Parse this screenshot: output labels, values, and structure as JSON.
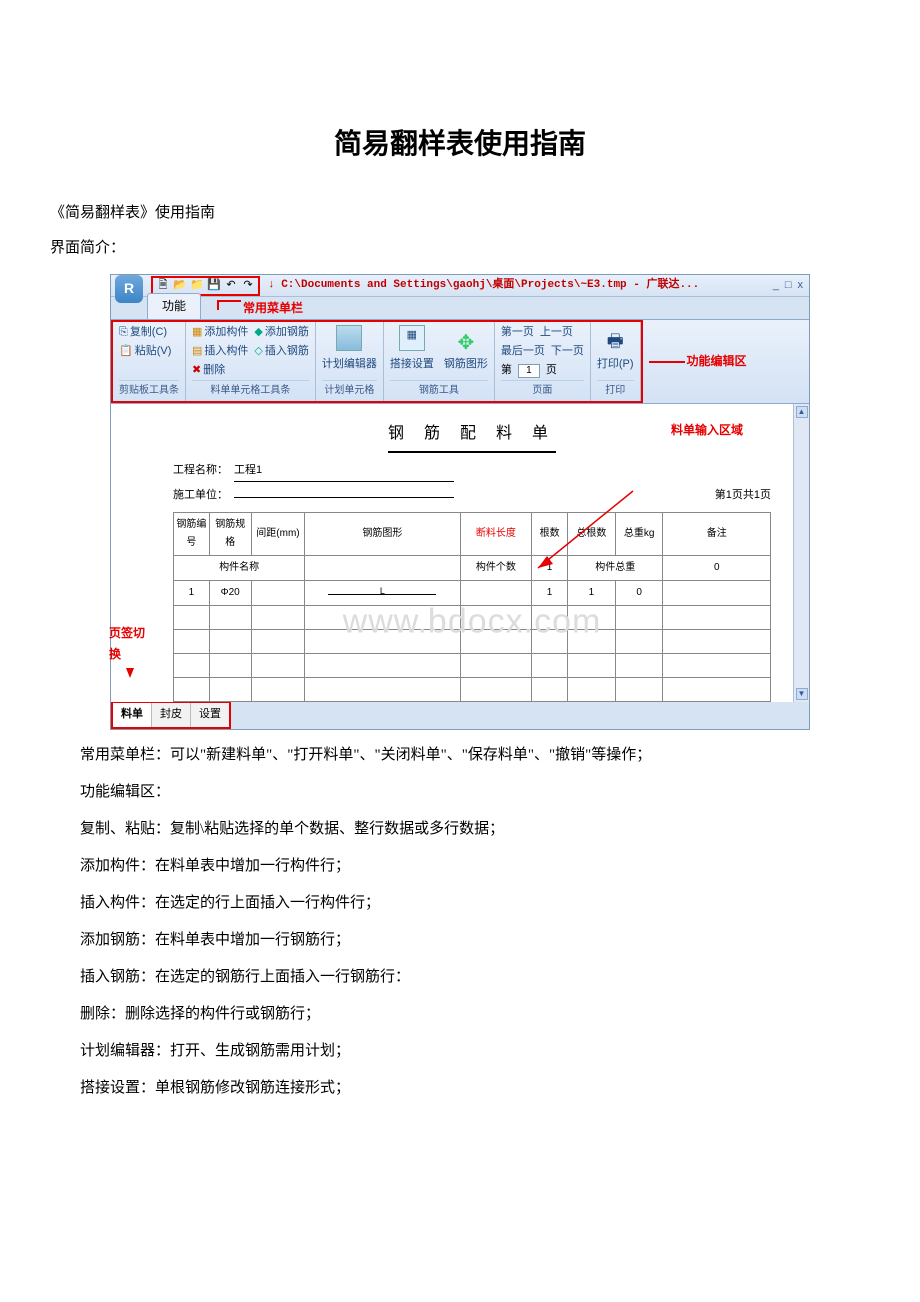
{
  "doc": {
    "title": "简易翻样表使用指南",
    "subtitle": "《简易翻样表》使用指南",
    "intro": "界面简介："
  },
  "app": {
    "logo_letter": "R",
    "title_path": "↓ C:\\Documents and Settings\\gaohj\\桌面\\Projects\\~E3.tmp - 广联达...",
    "win": {
      "min": "_",
      "max": "□",
      "close": "x"
    },
    "ribbon_tab": "功能",
    "annot_menu": "常用菜单栏",
    "annot_func": "功能编辑区",
    "annot_tabswitch": "页签切换",
    "annot_input": "料单输入区域"
  },
  "qat": {
    "new": "🗎",
    "open": "📂",
    "close": "📁",
    "save": "💾",
    "undo": "↶",
    "redo": "↷"
  },
  "ribbon": {
    "clipboard": {
      "copy": "复制(C)",
      "paste": "粘贴(V)",
      "label": "剪贴板工具条"
    },
    "cell": {
      "add_comp": "添加构件",
      "ins_comp": "插入构件",
      "del": "删除",
      "add_rebar": "添加钢筋",
      "ins_rebar": "插入钢筋",
      "label": "料单单元格工具条"
    },
    "plan": {
      "editor": "计划编辑器",
      "label": "计划单元格"
    },
    "tools": {
      "lap": "搭接设置",
      "shape": "钢筋图形",
      "label": "钢筋工具"
    },
    "page": {
      "first": "第一页",
      "last": "最后一页",
      "prev": "上一页",
      "next": "下一页",
      "num_prefix": "第",
      "num_value": "1",
      "num_suffix": "页",
      "label": "页面"
    },
    "print": {
      "btn": "打印(P)",
      "label": "打印"
    }
  },
  "sheet": {
    "title": "钢 筋 配 料 单",
    "proj_label": "工程名称：",
    "proj_value": "工程1",
    "unit_label": "施工单位：",
    "unit_value": "",
    "pager": "第1页共1页",
    "headers": {
      "no": "钢筋编号",
      "spec": "钢筋规格",
      "span": "间距(mm)",
      "shape": "钢筋图形",
      "cut": "断料长度",
      "count": "根数",
      "total": "总根数",
      "weight": "总重kg",
      "note": "备注"
    },
    "comp_row": {
      "name_label": "构件名称",
      "count_label": "构件个数",
      "weight_label": "构件总重",
      "count_val": "1",
      "weight_val": "0"
    },
    "data_row": {
      "no": "1",
      "spec": "Φ20",
      "span": "",
      "shape_L": "L",
      "cut": "",
      "count": "1",
      "total": "1",
      "weight": "0",
      "note": ""
    }
  },
  "tabs": {
    "t1": "料单",
    "t2": "封皮",
    "t3": "设置"
  },
  "watermark": "www.bdocx.com",
  "explain": {
    "p1": "常用菜单栏：可以\"新建料单\"、\"打开料单\"、\"关闭料单\"、\"保存料单\"、\"撤销\"等操作；",
    "p2": "功能编辑区：",
    "p3": "复制、粘贴：复制\\粘贴选择的单个数据、整行数据或多行数据；",
    "p4": "添加构件：在料单表中增加一行构件行；",
    "p5": "插入构件：在选定的行上面插入一行构件行；",
    "p6": "添加钢筋：在料单表中增加一行钢筋行；",
    "p7": "插入钢筋：在选定的钢筋行上面插入一行钢筋行：",
    "p8": "删除：删除选择的构件行或钢筋行；",
    "p9": "计划编辑器：打开、生成钢筋需用计划；",
    "p10": "搭接设置：单根钢筋修改钢筋连接形式；"
  }
}
